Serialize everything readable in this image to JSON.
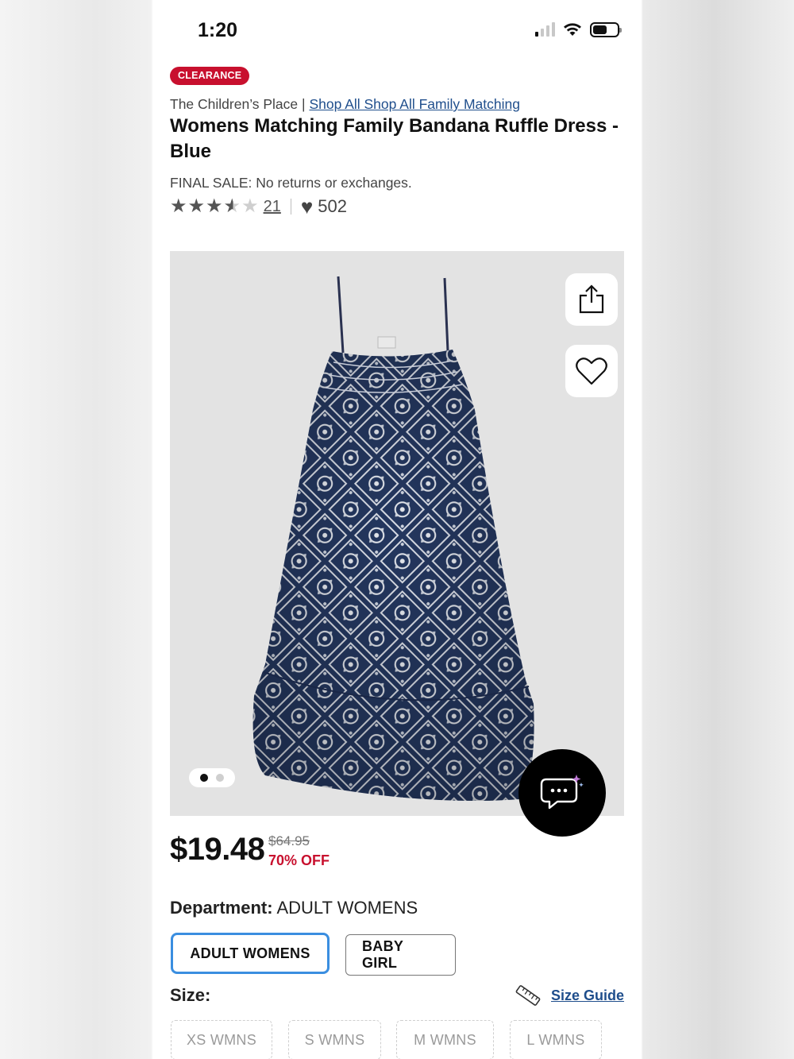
{
  "status_bar": {
    "time": "1:20"
  },
  "product": {
    "badge": "CLEARANCE",
    "brand": "The Children’s Place",
    "brand_separator": " | ",
    "category_link": "Shop All Shop All Family Matching",
    "title": "Womens Matching Family Bandana Ruffle Dress - Blue",
    "final_sale": "FINAL SALE: No returns or exchanges.",
    "rating": 3.5,
    "review_count": "21",
    "favorites_count": "502",
    "image_count": 2,
    "active_image": 1,
    "price": "$19.48",
    "original_price": "$64.95",
    "discount": "70% OFF"
  },
  "department": {
    "label": "Department:",
    "selected": "ADULT WOMENS",
    "options": [
      "ADULT WOMENS",
      "BABY GIRL"
    ]
  },
  "size": {
    "label": "Size:",
    "guide_label": "Size Guide",
    "options": [
      "XS WMNS",
      "S WMNS",
      "M WMNS",
      "L WMNS"
    ]
  },
  "colors": {
    "clearance_red": "#c8102e",
    "link_blue": "#1f4e8c",
    "selected_border": "#3a8ee0",
    "dress_navy": "#24375f"
  }
}
